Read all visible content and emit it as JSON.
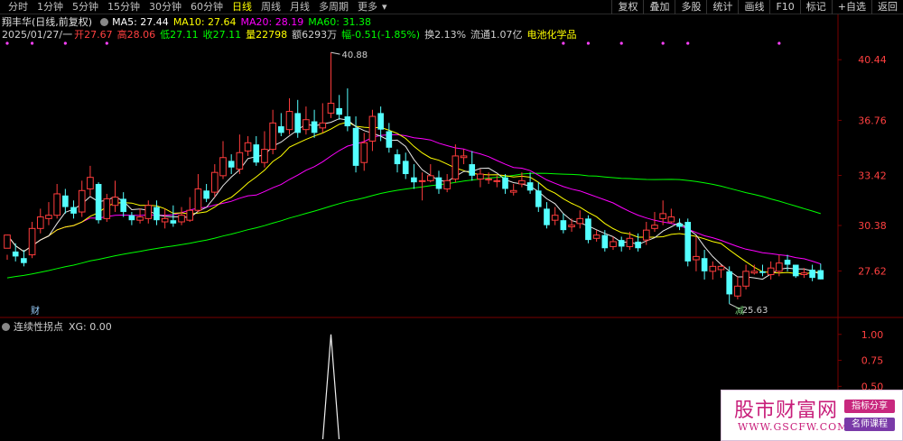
{
  "toolbar": {
    "periods": [
      {
        "label": "分时",
        "active": false
      },
      {
        "label": "1分钟",
        "active": false
      },
      {
        "label": "5分钟",
        "active": false
      },
      {
        "label": "15分钟",
        "active": false
      },
      {
        "label": "30分钟",
        "active": false
      },
      {
        "label": "60分钟",
        "active": false
      },
      {
        "label": "日线",
        "active": true
      },
      {
        "label": "周线",
        "active": false
      },
      {
        "label": "月线",
        "active": false
      },
      {
        "label": "多周期",
        "active": false
      },
      {
        "label": "更多",
        "active": false
      }
    ],
    "more_arrow": "▾",
    "tools": [
      "复权",
      "叠加",
      "多股",
      "统计",
      "画线",
      "F10",
      "标记",
      "+自选",
      "返回"
    ]
  },
  "header": {
    "stock_name": "翔丰华(日线,前复权)",
    "ma5": "MA5: 27.44",
    "ma10": "MA10: 27.64",
    "ma20": "MA20: 28.19",
    "ma60": "MA60: 31.38",
    "date": "2025/01/27/一",
    "open": "开27.67",
    "high": "高28.06",
    "low": "低27.11",
    "close": "收27.11",
    "volume": "量22798",
    "amount": "额6293万",
    "change": "幅-0.51(-1.85%)",
    "turnover": "换2.13%",
    "float_cap": "流通1.07亿",
    "sector": "电池化学品"
  },
  "sub_indicator": {
    "name": "连续性拐点",
    "value": "XG: 0.00"
  },
  "annotations": {
    "high_label": "40.88",
    "low_label": "25.63",
    "finance_marker": "财",
    "reduce_marker": "减"
  },
  "watermark": {
    "title": "股市财富网",
    "url": "WWW.GSCFW.COM",
    "tag1": "指标分享",
    "tag2": "名师课程"
  },
  "colors": {
    "up": "#ff3c3c",
    "down": "#54ffff",
    "ma5": "#ffffff",
    "ma10": "#ffff00",
    "ma20": "#ff00ff",
    "ma60": "#00ff00",
    "grid": "#7a0000",
    "axis_text": "#ff4040"
  },
  "chart_data": {
    "type": "candlestick",
    "price_axis": {
      "ylim": [
        24.8,
        41.6
      ],
      "ticks": [
        40.44,
        36.76,
        33.42,
        30.38,
        27.62
      ]
    },
    "indicator_axis": {
      "ylim": [
        0,
        1.05
      ],
      "ticks": [
        1.0,
        0.75,
        0.5,
        0.25
      ]
    },
    "candles": [
      [
        29.0,
        29.8,
        28.6,
        28.3
      ],
      [
        28.8,
        28.5,
        29.3,
        28.2
      ],
      [
        28.4,
        28.1,
        28.9,
        27.9
      ],
      [
        28.6,
        30.2,
        30.6,
        28.4
      ],
      [
        30.2,
        30.9,
        31.4,
        29.9
      ],
      [
        30.8,
        31.0,
        31.8,
        30.4
      ],
      [
        31.0,
        32.3,
        32.9,
        30.8
      ],
      [
        32.2,
        31.5,
        32.6,
        31.1
      ],
      [
        31.5,
        31.1,
        31.9,
        30.8
      ],
      [
        31.2,
        32.5,
        33.1,
        30.9
      ],
      [
        32.6,
        33.3,
        34.0,
        32.2
      ],
      [
        32.9,
        30.7,
        33.0,
        30.5
      ],
      [
        30.8,
        32.0,
        32.3,
        30.6
      ],
      [
        31.6,
        32.1,
        33.1,
        31.2
      ],
      [
        32.0,
        31.2,
        32.4,
        30.9
      ],
      [
        31.0,
        30.7,
        31.2,
        30.4
      ],
      [
        30.7,
        30.9,
        31.4,
        30.5
      ],
      [
        30.8,
        31.6,
        31.9,
        30.5
      ],
      [
        31.5,
        30.7,
        31.9,
        30.4
      ],
      [
        30.6,
        30.8,
        31.4,
        30.2
      ],
      [
        30.7,
        30.5,
        31.6,
        30.3
      ],
      [
        30.6,
        31.0,
        31.5,
        30.4
      ],
      [
        30.7,
        31.3,
        32.1,
        30.6
      ],
      [
        31.3,
        32.6,
        33.5,
        31.2
      ],
      [
        32.5,
        32.0,
        32.9,
        31.8
      ],
      [
        32.4,
        33.6,
        34.1,
        32.1
      ],
      [
        33.4,
        34.5,
        35.5,
        33.2
      ],
      [
        34.3,
        33.9,
        34.7,
        33.5
      ],
      [
        33.8,
        34.8,
        35.9,
        33.5
      ],
      [
        34.9,
        35.4,
        35.8,
        34.6
      ],
      [
        35.3,
        34.2,
        35.8,
        34.0
      ],
      [
        34.2,
        35.0,
        36.1,
        33.9
      ],
      [
        35.0,
        36.6,
        37.4,
        34.7
      ],
      [
        36.4,
        36.0,
        37.2,
        35.8
      ],
      [
        36.2,
        37.3,
        38.1,
        35.9
      ],
      [
        37.2,
        36.0,
        38.0,
        35.7
      ],
      [
        36.2,
        36.8,
        37.6,
        35.9
      ],
      [
        36.7,
        36.0,
        37.4,
        35.7
      ],
      [
        36.3,
        36.6,
        37.8,
        36.0
      ],
      [
        37.2,
        37.8,
        40.88,
        36.9
      ],
      [
        37.5,
        37.1,
        38.3,
        36.8
      ],
      [
        37.0,
        36.4,
        38.7,
        36.1
      ],
      [
        36.3,
        34.0,
        37.0,
        33.6
      ],
      [
        34.2,
        35.4,
        36.0,
        33.7
      ],
      [
        35.5,
        37.0,
        37.4,
        34.9
      ],
      [
        37.2,
        36.2,
        37.6,
        35.5
      ],
      [
        36.1,
        35.1,
        36.6,
        34.8
      ],
      [
        34.7,
        34.1,
        35.0,
        33.6
      ],
      [
        34.3,
        33.5,
        34.8,
        33.2
      ],
      [
        33.3,
        33.0,
        34.1,
        32.6
      ],
      [
        33.1,
        33.1,
        33.6,
        31.9
      ],
      [
        33.1,
        33.4,
        34.1,
        33.0
      ],
      [
        33.3,
        32.6,
        33.7,
        32.3
      ],
      [
        32.6,
        33.1,
        33.5,
        32.4
      ],
      [
        33.2,
        34.6,
        35.3,
        33.0
      ],
      [
        34.5,
        34.6,
        35.0,
        34.1
      ],
      [
        34.1,
        33.4,
        34.9,
        33.1
      ],
      [
        33.2,
        33.5,
        33.8,
        32.7
      ],
      [
        33.2,
        33.2,
        33.6,
        32.9
      ],
      [
        33.1,
        33.1,
        33.4,
        32.7
      ],
      [
        33.3,
        32.6,
        33.5,
        32.3
      ],
      [
        32.4,
        32.5,
        32.9,
        32.2
      ],
      [
        32.9,
        33.1,
        33.6,
        32.7
      ],
      [
        33.0,
        32.5,
        33.6,
        32.3
      ],
      [
        32.5,
        31.5,
        33.0,
        31.2
      ],
      [
        31.4,
        30.4,
        31.8,
        30.2
      ],
      [
        30.7,
        31.0,
        31.5,
        30.4
      ],
      [
        30.7,
        30.1,
        31.1,
        29.9
      ],
      [
        30.3,
        30.4,
        30.8,
        30.0
      ],
      [
        30.5,
        30.8,
        31.3,
        30.2
      ],
      [
        30.8,
        29.5,
        31.0,
        29.3
      ],
      [
        29.6,
        29.8,
        30.1,
        29.4
      ],
      [
        29.8,
        29.0,
        30.1,
        28.8
      ],
      [
        29.1,
        29.4,
        29.7,
        28.9
      ],
      [
        29.5,
        29.1,
        29.7,
        28.8
      ],
      [
        29.1,
        29.6,
        30.0,
        28.9
      ],
      [
        29.4,
        29.0,
        29.9,
        28.8
      ],
      [
        29.5,
        30.1,
        30.6,
        29.2
      ],
      [
        30.2,
        30.4,
        31.2,
        30.0
      ],
      [
        30.8,
        31.1,
        31.9,
        30.4
      ],
      [
        30.6,
        30.9,
        31.4,
        30.5
      ],
      [
        30.5,
        30.3,
        30.8,
        30.1
      ],
      [
        30.6,
        28.2,
        30.8,
        27.9
      ],
      [
        28.3,
        28.5,
        29.7,
        27.6
      ],
      [
        28.4,
        27.6,
        28.9,
        27.1
      ],
      [
        27.6,
        27.9,
        28.2,
        27.1
      ],
      [
        27.7,
        27.9,
        28.0,
        27.2
      ],
      [
        27.6,
        26.2,
        27.9,
        25.63
      ],
      [
        26.1,
        26.7,
        27.3,
        25.9
      ],
      [
        26.7,
        27.6,
        28.0,
        26.5
      ],
      [
        27.5,
        27.6,
        28.0,
        27.4
      ],
      [
        27.6,
        27.5,
        28.0,
        27.3
      ],
      [
        27.4,
        27.8,
        28.2,
        27.1
      ],
      [
        27.6,
        28.1,
        28.6,
        27.3
      ],
      [
        28.3,
        28.0,
        28.6,
        27.6
      ],
      [
        28.0,
        27.3,
        28.0,
        27.2
      ],
      [
        27.4,
        27.5,
        27.8,
        27.2
      ],
      [
        27.7,
        27.2,
        28.0,
        27.0
      ],
      [
        27.67,
        27.11,
        28.06,
        27.11
      ]
    ],
    "ma60_start": [
      4,
      29.4
    ],
    "ma60_end": [
      96,
      31.38
    ],
    "indicator_peak_index": 39,
    "indicator_values_note": "XG pulse = 1 at one bar, otherwise 0"
  }
}
